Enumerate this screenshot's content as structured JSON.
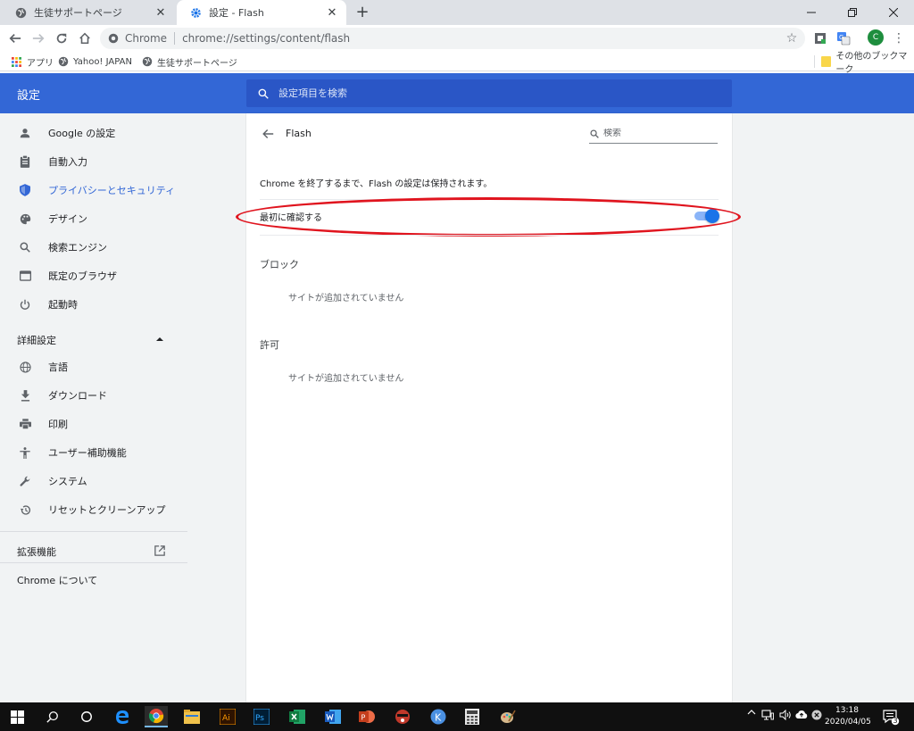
{
  "browser": {
    "tabs": [
      {
        "title": "生徒サポートページ",
        "active": false
      },
      {
        "title": "設定 - Flash",
        "active": true
      }
    ],
    "new_tab": "+",
    "omnibox": {
      "scheme_label": "Chrome",
      "url": "chrome://settings/content/flash"
    },
    "avatar_letter": "C",
    "bookmarks": [
      {
        "label": "アプリ",
        "icon": "apps-grid-icon"
      },
      {
        "label": "Yahoo! JAPAN",
        "icon": "globe-icon"
      },
      {
        "label": "生徒サポートページ",
        "icon": "globe-icon"
      }
    ],
    "other_bookmarks": "その他のブックマーク"
  },
  "settings": {
    "title": "設定",
    "search_placeholder": "設定項目を検索",
    "sidebar": {
      "items": [
        {
          "label": "Google の設定",
          "icon": "person-icon"
        },
        {
          "label": "自動入力",
          "icon": "clipboard-icon"
        },
        {
          "label": "プライバシーとセキュリティ",
          "icon": "shield-icon",
          "selected": true
        },
        {
          "label": "デザイン",
          "icon": "palette-icon"
        },
        {
          "label": "検索エンジン",
          "icon": "search-icon"
        },
        {
          "label": "既定のブラウザ",
          "icon": "browser-window-icon"
        },
        {
          "label": "起動時",
          "icon": "power-icon"
        }
      ],
      "advanced_label": "詳細設定",
      "advanced_items": [
        {
          "label": "言語",
          "icon": "globe-icon"
        },
        {
          "label": "ダウンロード",
          "icon": "download-icon"
        },
        {
          "label": "印刷",
          "icon": "printer-icon"
        },
        {
          "label": "ユーザー補助機能",
          "icon": "accessibility-icon"
        },
        {
          "label": "システム",
          "icon": "wrench-icon"
        },
        {
          "label": "リセットとクリーンアップ",
          "icon": "history-icon"
        }
      ],
      "extensions_label": "拡張機能",
      "about_label": "Chrome について"
    },
    "page": {
      "title": "Flash",
      "search_placeholder": "検索",
      "description": "Chrome を終了するまで、Flash の設定は保持されます。",
      "toggle_label": "最初に確認する",
      "toggle_on": true,
      "block_label": "ブロック",
      "block_empty": "サイトが追加されていません",
      "allow_label": "許可",
      "allow_empty": "サイトが追加されていません"
    }
  },
  "taskbar": {
    "time": "13:18",
    "date": "2020/04/05",
    "notification_count": "3"
  },
  "colors": {
    "header_blue": "#3367d6",
    "search_blue": "#2a56c6",
    "toggle_blue": "#1a73e8",
    "highlight_red": "#e0141e"
  }
}
